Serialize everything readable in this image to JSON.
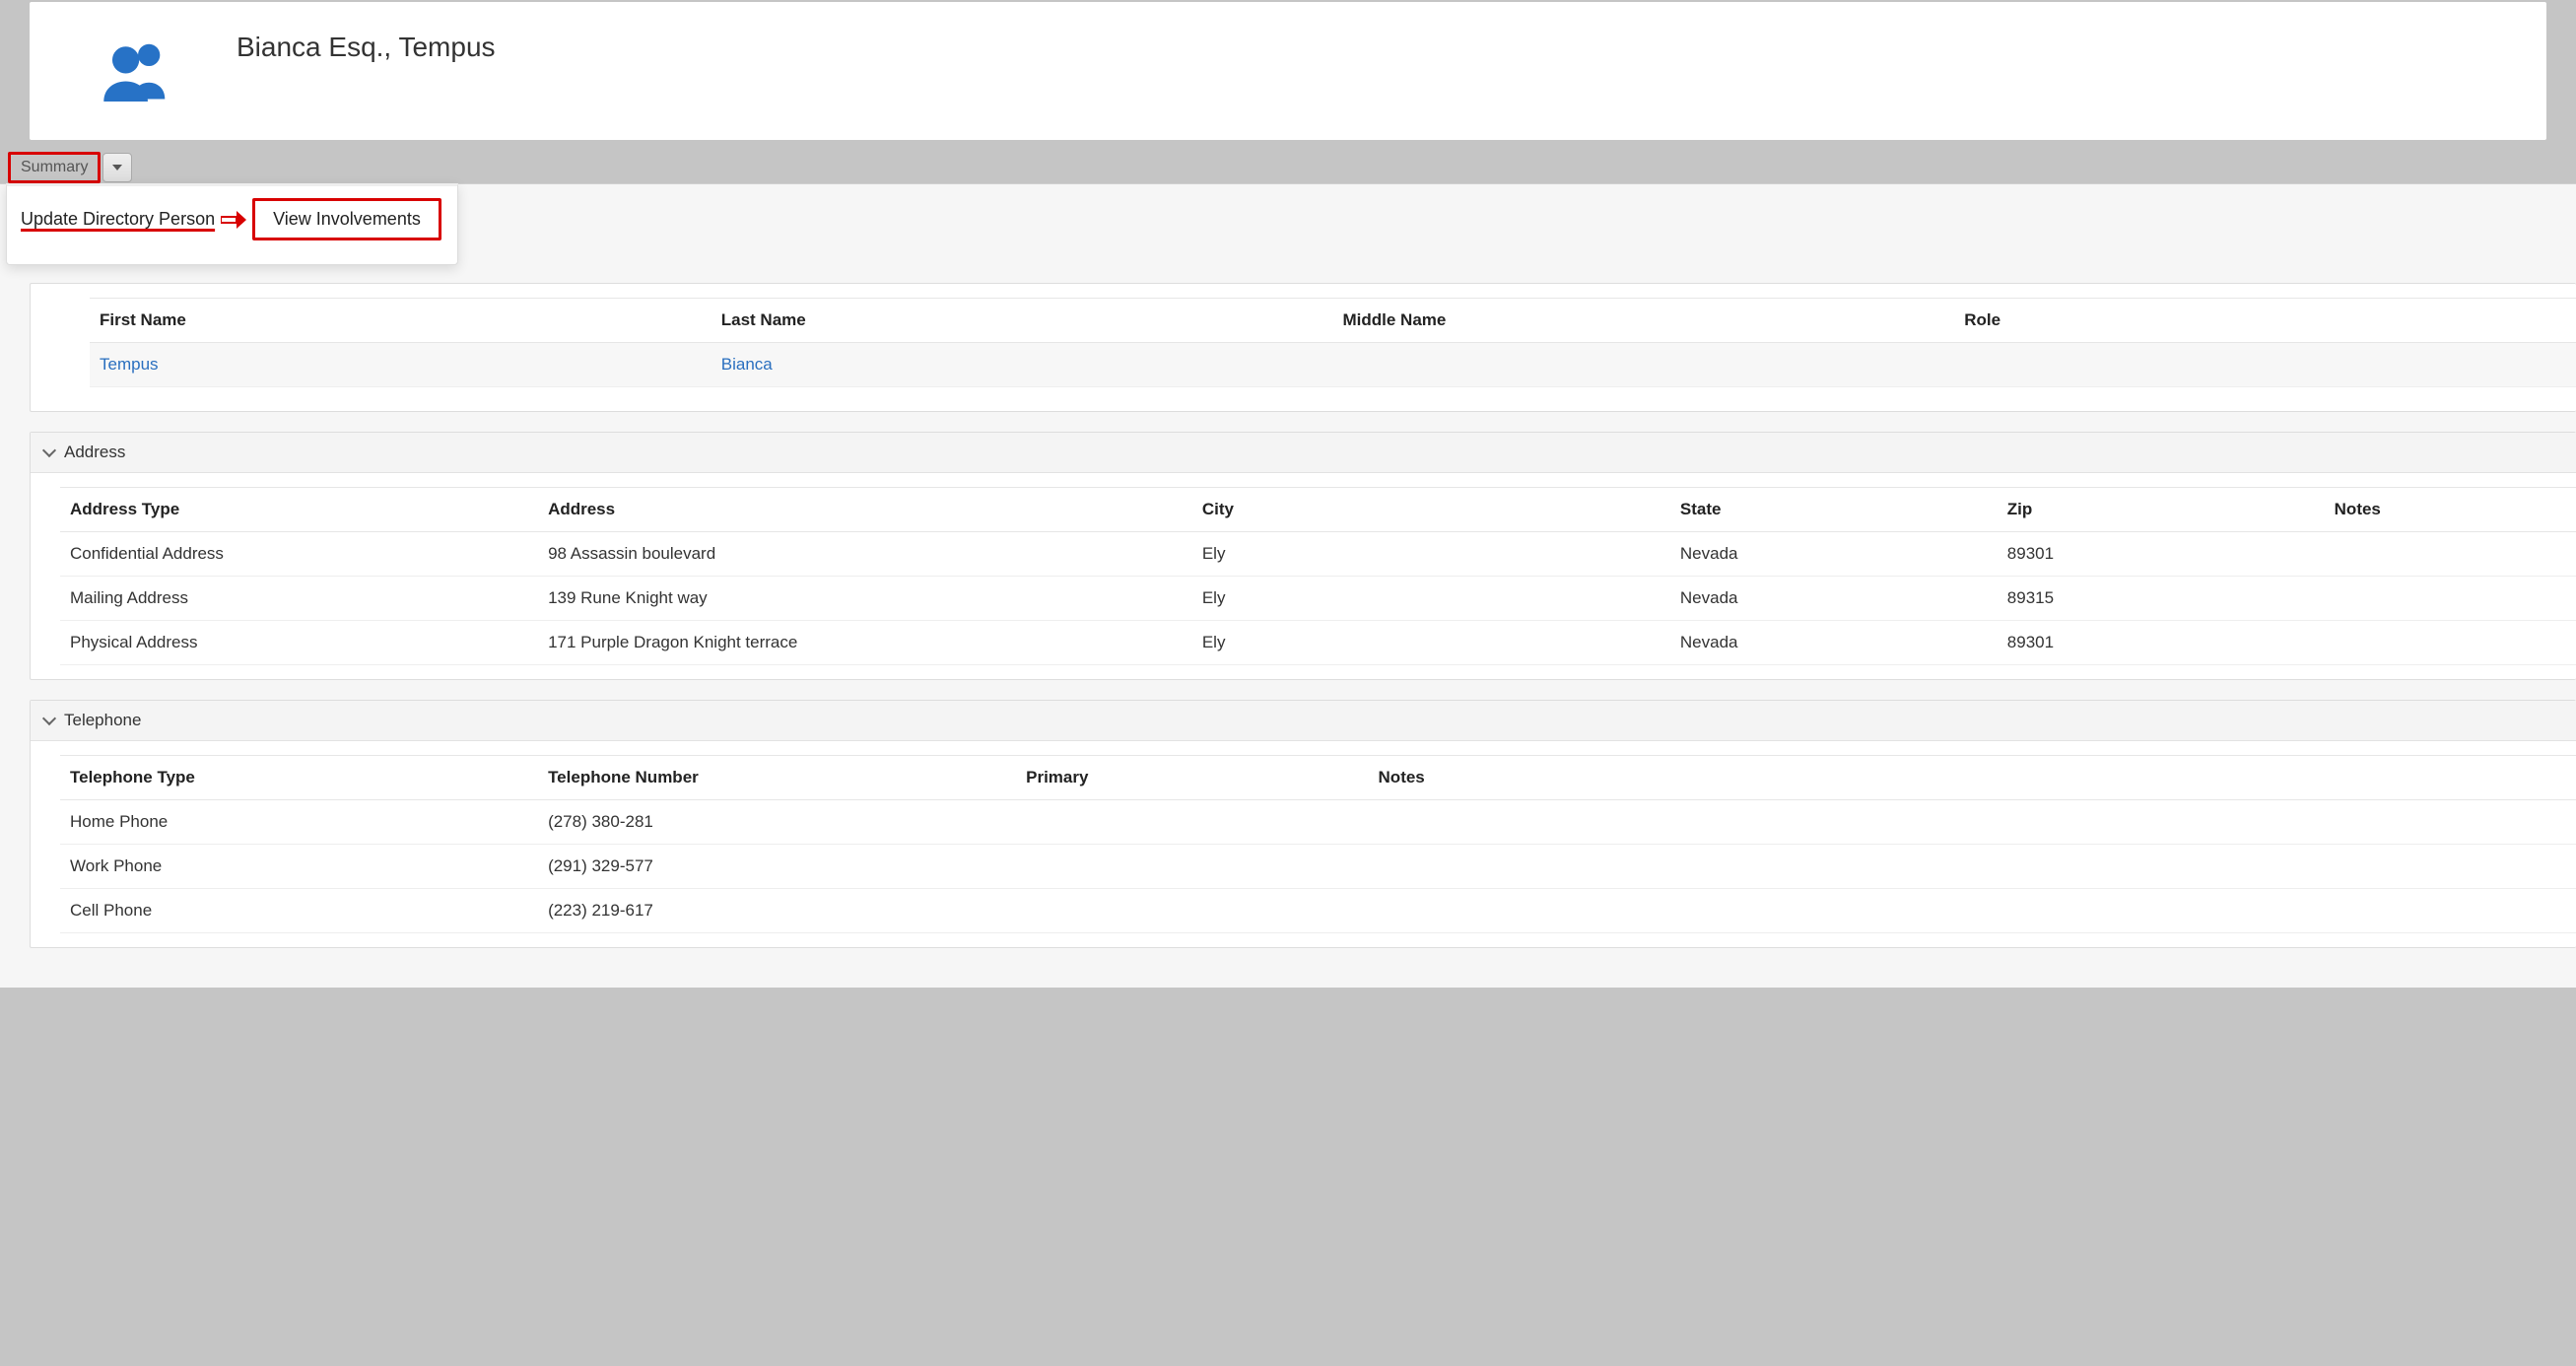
{
  "header": {
    "title": "Bianca Esq., Tempus"
  },
  "tabs": {
    "summary": "Summary"
  },
  "menu": {
    "update": "Update Directory Person",
    "view": "View Involvements"
  },
  "name_section": {
    "columns": [
      "First Name",
      "Last Name",
      "Middle Name",
      "Role"
    ],
    "row": {
      "first_name": "Tempus",
      "last_name": "Bianca",
      "middle_name": "",
      "role": ""
    }
  },
  "address_section": {
    "title": "Address",
    "columns": [
      "Address Type",
      "Address",
      "City",
      "State",
      "Zip",
      "Notes"
    ],
    "rows": [
      {
        "type": "Confidential Address",
        "address": "98 Assassin boulevard",
        "city": "Ely",
        "state": "Nevada",
        "zip": "89301",
        "notes": ""
      },
      {
        "type": "Mailing Address",
        "address": "139 Rune Knight way",
        "city": "Ely",
        "state": "Nevada",
        "zip": "89315",
        "notes": ""
      },
      {
        "type": "Physical Address",
        "address": "171 Purple Dragon Knight terrace",
        "city": "Ely",
        "state": "Nevada",
        "zip": "89301",
        "notes": ""
      }
    ]
  },
  "telephone_section": {
    "title": "Telephone",
    "columns": [
      "Telephone Type",
      "Telephone Number",
      "Primary",
      "Notes"
    ],
    "rows": [
      {
        "type": "Home Phone",
        "number": "(278) 380-281",
        "primary": "",
        "notes": ""
      },
      {
        "type": "Work Phone",
        "number": "(291) 329-577",
        "primary": "",
        "notes": ""
      },
      {
        "type": "Cell Phone",
        "number": "(223) 219-617",
        "primary": "",
        "notes": ""
      }
    ]
  }
}
